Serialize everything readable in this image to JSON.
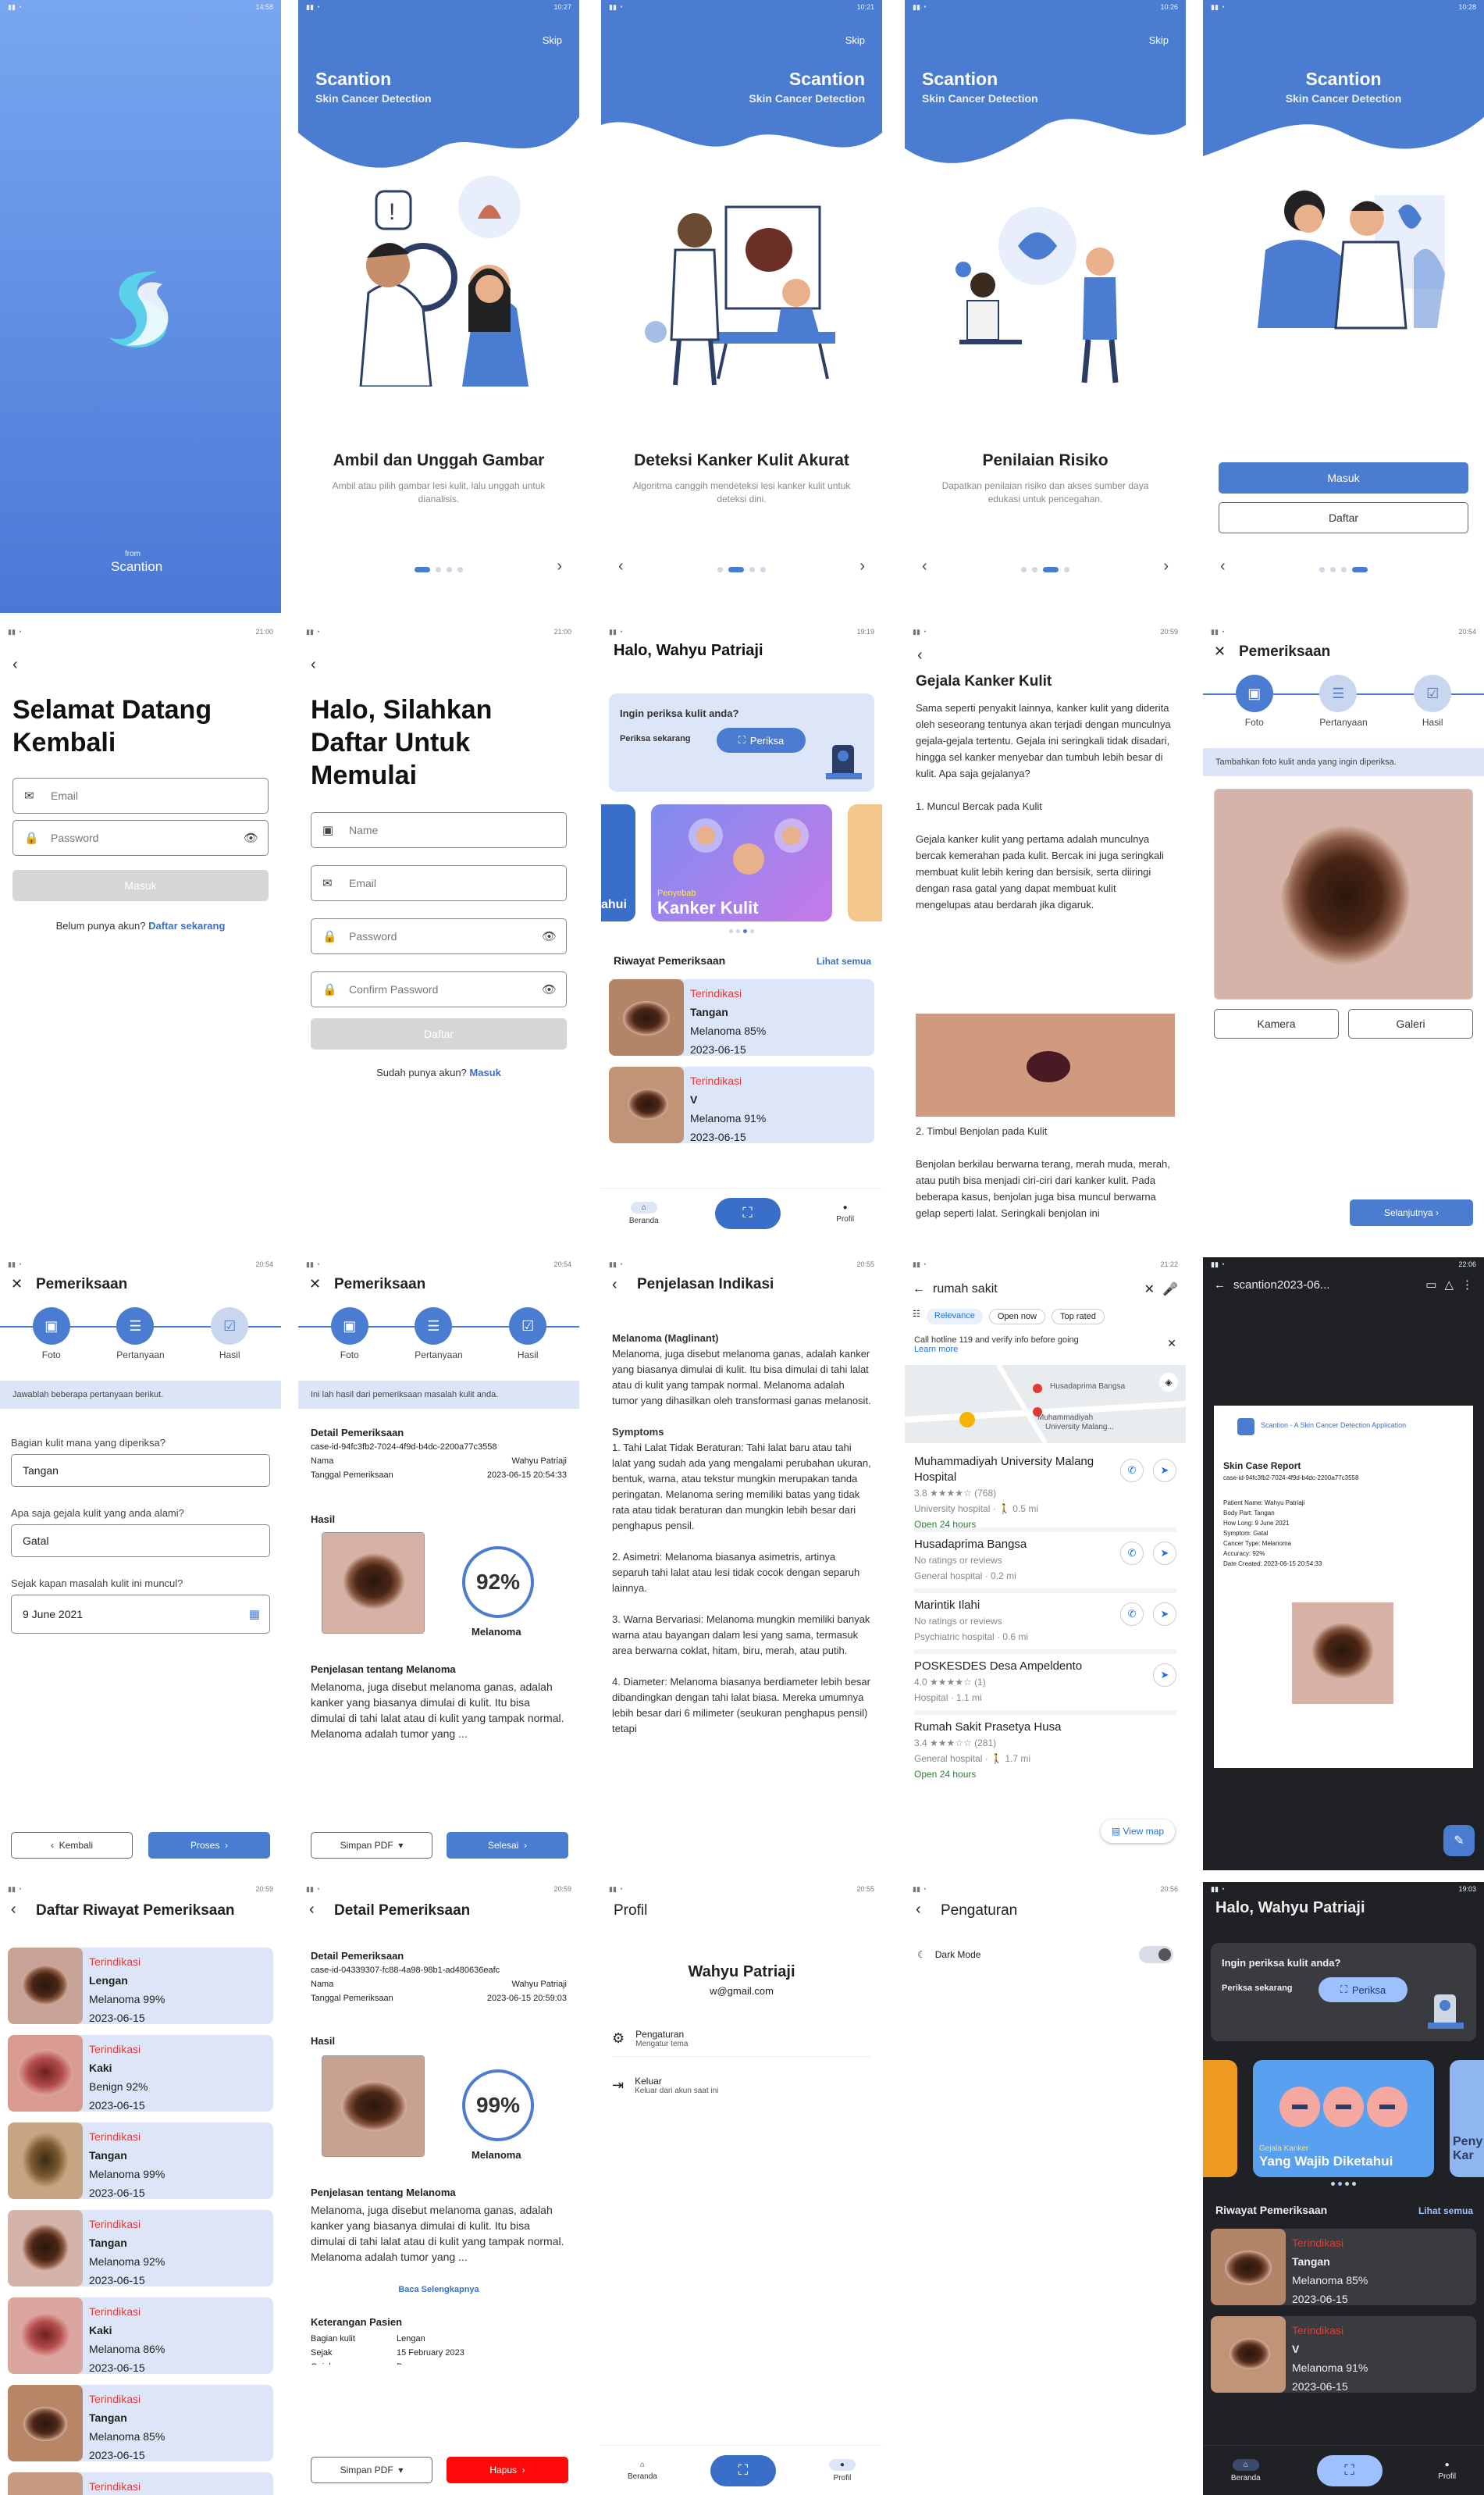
{
  "status": {
    "s1": "14:58",
    "s2": "10:27",
    "s3": "10:21",
    "s4": "10:26",
    "s5": "10:28",
    "s6": "21:00",
    "s7": "21:00",
    "s8": "19:19",
    "s9": "20:59",
    "s10": "20:54",
    "s11": "20:54",
    "s12": "20:54",
    "s13": "20:55",
    "s14": "21:22",
    "s15": "22:06",
    "s16": "20:59",
    "s17": "20:59",
    "s18": "20:55",
    "s19": "20:56",
    "s20": "19:03"
  },
  "splash": {
    "from": "from",
    "brand": "Scantion"
  },
  "onboarding": {
    "app_title": "Scantion",
    "app_sub": "Skin Cancer Detection",
    "skip": "Skip",
    "slides": [
      {
        "title": "Ambil dan Unggah Gambar",
        "desc": "Ambil atau pilih gambar lesi kulit, lalu unggah untuk dianalisis."
      },
      {
        "title": "Deteksi Kanker Kulit Akurat",
        "desc": "Algoritma canggih mendeteksi lesi kanker kulit untuk deteksi dini."
      },
      {
        "title": "Penilaian Risiko",
        "desc": "Dapatkan penilaian risiko dan akses sumber daya edukasi untuk pencegahan."
      }
    ],
    "login": "Masuk",
    "register": "Daftar"
  },
  "login": {
    "title": "Selamat Datang Kembali",
    "email_ph": "Email",
    "password_ph": "Password",
    "button": "Masuk",
    "no_account": "Belum punya akun?",
    "register_link": "Daftar sekarang"
  },
  "register": {
    "title": "Halo, Silahkan Daftar Untuk Memulai",
    "name_ph": "Name",
    "email_ph": "Email",
    "password_ph": "Password",
    "confirm_ph": "Confirm Password",
    "button": "Daftar",
    "have_account": "Sudah punya akun?",
    "login_link": "Masuk"
  },
  "home": {
    "greeting": "Halo, Wahyu Patriaji",
    "prompt": "Ingin periksa kulit anda?",
    "check_now": "Periksa sekarang",
    "check_btn": "Periksa",
    "banner_small": "Penyebab",
    "banner_big": "Kanker Kulit",
    "banner_left": "ahui",
    "history_title": "Riwayat Pemeriksaan",
    "see_all": "Lihat semua",
    "history": [
      {
        "status": "Terindikasi",
        "part": "Tangan",
        "result": "Melanoma 85%",
        "date": "2023-06-15"
      },
      {
        "status": "Terindikasi",
        "part": "V",
        "result": "Melanoma 91%",
        "date": "2023-06-15"
      }
    ],
    "tab_home": "Beranda",
    "tab_profile": "Profil"
  },
  "article": {
    "title": "Gejala Kanker Kulit",
    "p1": "Sama seperti penyakit lainnya, kanker kulit yang diderita oleh seseorang tentunya akan terjadi dengan munculnya gejala-gejala tertentu. Gejala ini seringkali tidak disadari, hingga sel kanker menyebar dan tumbuh lebih besar di kulit. Apa saja gejalanya?",
    "h1": "1. Muncul Bercak pada Kulit",
    "p2": "Gejala kanker kulit yang pertama adalah munculnya bercak kemerahan pada kulit. Bercak ini juga seringkali membuat kulit lebih kering dan bersisik, serta diiringi dengan rasa gatal yang dapat membuat kulit mengelupas atau berdarah jika digaruk.",
    "h2": "2. Timbul Benjolan pada Kulit",
    "p3": "Benjolan berkilau berwarna terang, merah muda, merah, atau putih bisa menjadi ciri-ciri dari kanker kulit. Pada beberapa kasus, benjolan juga bisa muncul berwarna gelap seperti lalat. Seringkali benjolan ini"
  },
  "exam": {
    "title": "Pemeriksaan",
    "steps": [
      "Foto",
      "Pertanyaan",
      "Hasil"
    ],
    "photo_hint": "Tambahkan foto kulit anda yang ingin diperiksa.",
    "camera": "Kamera",
    "gallery": "Galeri",
    "next": "Selanjutnya",
    "q_hint": "Jawablah beberapa pertanyaan berikut.",
    "q1": "Bagian kulit mana yang diperiksa?",
    "a1": "Tangan",
    "q2": "Apa saja gejala kulit yang anda alami?",
    "a2": "Gatal",
    "q3": "Sejak kapan masalah kulit ini muncul?",
    "a3": "9 June 2021",
    "back": "Kembali",
    "process": "Proses",
    "r_hint": "Ini lah hasil dari pemeriksaan masalah kulit anda.",
    "detail_title": "Detail Pemeriksaan",
    "case_id": "case-id-94fc3fb2-7024-4f9d-b4dc-2200a77c3558",
    "name_k": "Nama",
    "name_v": "Wahyu Patriaji",
    "date_k": "Tanggal Pemeriksaan",
    "date_v": "2023-06-15 20:54:33",
    "result_title": "Hasil",
    "score": "92%",
    "label": "Melanoma",
    "expl_title": "Penjelasan tentang Melanoma",
    "expl": "Melanoma, juga disebut melanoma ganas, adalah kanker yang biasanya dimulai di kulit. Itu bisa dimulai di tahi lalat atau di kulit yang tampak normal. Melanoma adalah tumor yang ...",
    "save_pdf": "Simpan PDF",
    "done": "Selesai"
  },
  "explain": {
    "title": "Penjelasan Indikasi",
    "h": "Melanoma (Maglinant)",
    "p": "Melanoma, juga disebut melanoma ganas, adalah kanker yang biasanya dimulai di kulit. Itu bisa dimulai di tahi lalat atau di kulit yang tampak normal. Melanoma adalah tumor yang dihasilkan oleh transformasi ganas melanosit.",
    "sym": "Symptoms",
    "s1": "1. Tahi Lalat Tidak Beraturan: Tahi lalat baru atau tahi lalat yang sudah ada yang mengalami perubahan ukuran, bentuk, warna, atau tekstur mungkin merupakan tanda peringatan. Melanoma sering memiliki batas yang tidak rata atau tidak beraturan dan mungkin lebih besar dari penghapus pensil.",
    "s2": "2. Asimetri: Melanoma biasanya asimetris, artinya separuh tahi lalat atau lesi tidak cocok dengan separuh lainnya.",
    "s3": "3. Warna Bervariasi: Melanoma mungkin memiliki banyak warna atau bayangan dalam lesi yang sama, termasuk area berwarna coklat, hitam, biru, merah, atau putih.",
    "s4": "4. Diameter: Melanoma biasanya berdiameter lebih besar dibandingkan dengan tahi lalat biasa. Mereka umumnya lebih besar dari 6 milimeter (seukuran penghapus pensil) tetapi"
  },
  "maps": {
    "query": "rumah sakit",
    "chip1": "Relevance",
    "chip2": "Open now",
    "chip3": "Top rated",
    "notice": "Call hotline 119 and verify info before going",
    "learn": "Learn more",
    "map_label1": "Husadaprima Bangsa",
    "map_label2": "Muhammadiyah",
    "map_label3": "University Malang...",
    "view_map": "View map",
    "places": [
      {
        "name": "Muhammadiyah University Malang Hospital",
        "rating": "3.8 ★★★★☆ (768)",
        "type": "University hospital · 🚶 0.5 mi",
        "open": "Open 24 hours"
      },
      {
        "name": "Husadaprima Bangsa",
        "rating": "No ratings or reviews",
        "type": "General hospital · 0.2 mi",
        "open": ""
      },
      {
        "name": "Marintik Ilahi",
        "rating": "No ratings or reviews",
        "type": "Psychiatric hospital · 0.6 mi",
        "open": ""
      },
      {
        "name": "POSKESDES Desa Ampeldento",
        "rating": "4.0 ★★★★☆ (1)",
        "type": "Hospital · 1.1 mi",
        "open": ""
      },
      {
        "name": "Rumah Sakit Prasetya Husa",
        "rating": "3.4 ★★★☆☆ (281)",
        "type": "General hospital · 🚶 1.7 mi",
        "open": "Open 24 hours"
      }
    ]
  },
  "pdf": {
    "file": "scantion2023-06...",
    "header": "Scantion - A Skin Cancer Detection Application",
    "title": "Skin Case Report",
    "case": "case-id-94fc3fb2-7024-4f9d-b4dc-2200a77c3558",
    "l1": "Patient Name: Wahyu Patriaji",
    "l2": "Body Part: Tangan",
    "l3": "How Long: 9 June 2021",
    "l4": "Symptom: Gatal",
    "l5": "Cancer Type: Melanoma",
    "l6": "Accuracy: 92%",
    "l7": "Date Created: 2023-06-15 20:54:33"
  },
  "history_list": {
    "title": "Daftar Riwayat Pemeriksaan",
    "items": [
      {
        "status": "Terindikasi",
        "part": "Lengan",
        "result": "Melanoma 99%",
        "date": "2023-06-15"
      },
      {
        "status": "Terindikasi",
        "part": "Kaki",
        "result": "Benign 92%",
        "date": "2023-06-15"
      },
      {
        "status": "Terindikasi",
        "part": "Tangan",
        "result": "Melanoma 99%",
        "date": "2023-06-15"
      },
      {
        "status": "Terindikasi",
        "part": "Tangan",
        "result": "Melanoma 92%",
        "date": "2023-06-15"
      },
      {
        "status": "Terindikasi",
        "part": "Kaki",
        "result": "Melanoma 86%",
        "date": "2023-06-15"
      },
      {
        "status": "Terindikasi",
        "part": "Tangan",
        "result": "Melanoma 85%",
        "date": "2023-06-15"
      },
      {
        "status": "Terindikasi",
        "part": "",
        "result": "",
        "date": ""
      }
    ]
  },
  "detail": {
    "title": "Detail Pemeriksaan",
    "sub": "Detail Pemeriksaan",
    "case": "case-id-04339307-fc88-4a98-98b1-ad480636eafc",
    "name_k": "Nama",
    "name_v": "Wahyu Patriaji",
    "date_k": "Tanggal Pemeriksaan",
    "date_v": "2023-06-15 20:59:03",
    "hasil": "Hasil",
    "score": "99%",
    "label": "Melanoma",
    "expl_title": "Penjelasan tentang Melanoma",
    "expl": "Melanoma, juga disebut melanoma ganas, adalah kanker yang biasanya dimulai di kulit. Itu bisa dimulai di tahi lalat atau di kulit yang tampak normal. Melanoma adalah tumor yang ...",
    "read_more": "Baca Selengkapnya",
    "patient": "Keterangan Pasien",
    "bk": "Bagian kulit",
    "bv": "Lengan",
    "sk": "Sejak",
    "sv": "15 February 2023",
    "gk": "Gejala",
    "gv": "Panas",
    "save_pdf": "Simpan PDF",
    "delete": "Hapus"
  },
  "profile": {
    "title": "Profil",
    "name": "Wahyu Patriaji",
    "email": "w@gmail.com",
    "settings": "Pengaturan",
    "settings_sub": "Mengatur tema",
    "logout": "Keluar",
    "logout_sub": "Keluar dari akun saat ini"
  },
  "settings": {
    "title": "Pengaturan",
    "dark": "Dark Mode"
  },
  "dark_home": {
    "banner_small": "Gejala Kanker",
    "banner_big": "Yang Wajib Diketahui",
    "banner_right1": "Peny",
    "banner_right2": "Kar"
  },
  "colors": {
    "primary": "#4a7dd1",
    "card": "#dde6f8",
    "danger": "#e53935"
  }
}
